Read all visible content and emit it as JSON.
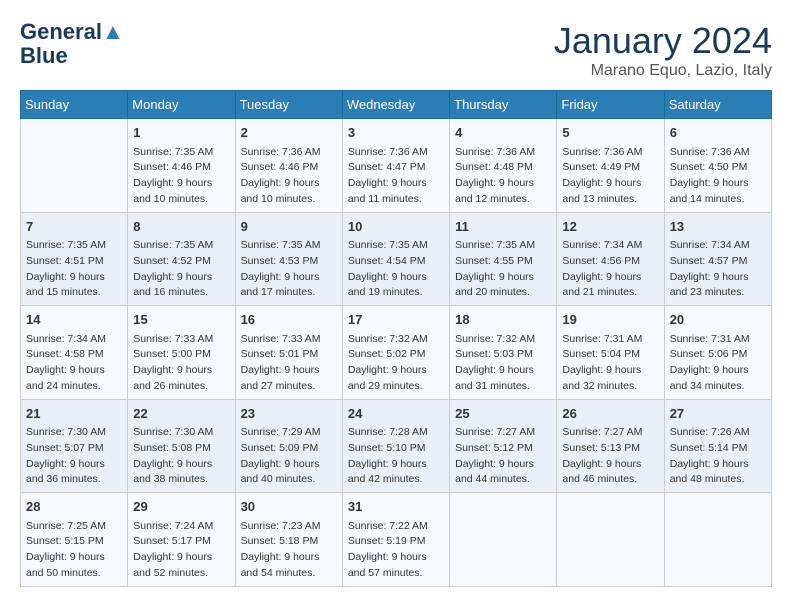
{
  "header": {
    "logo_line1": "General",
    "logo_line2": "Blue",
    "month": "January 2024",
    "location": "Marano Equo, Lazio, Italy"
  },
  "weekdays": [
    "Sunday",
    "Monday",
    "Tuesday",
    "Wednesday",
    "Thursday",
    "Friday",
    "Saturday"
  ],
  "weeks": [
    [
      {
        "day": "",
        "content": ""
      },
      {
        "day": "1",
        "content": "Sunrise: 7:35 AM\nSunset: 4:46 PM\nDaylight: 9 hours\nand 10 minutes."
      },
      {
        "day": "2",
        "content": "Sunrise: 7:36 AM\nSunset: 4:46 PM\nDaylight: 9 hours\nand 10 minutes."
      },
      {
        "day": "3",
        "content": "Sunrise: 7:36 AM\nSunset: 4:47 PM\nDaylight: 9 hours\nand 11 minutes."
      },
      {
        "day": "4",
        "content": "Sunrise: 7:36 AM\nSunset: 4:48 PM\nDaylight: 9 hours\nand 12 minutes."
      },
      {
        "day": "5",
        "content": "Sunrise: 7:36 AM\nSunset: 4:49 PM\nDaylight: 9 hours\nand 13 minutes."
      },
      {
        "day": "6",
        "content": "Sunrise: 7:36 AM\nSunset: 4:50 PM\nDaylight: 9 hours\nand 14 minutes."
      }
    ],
    [
      {
        "day": "7",
        "content": "Sunrise: 7:35 AM\nSunset: 4:51 PM\nDaylight: 9 hours\nand 15 minutes."
      },
      {
        "day": "8",
        "content": "Sunrise: 7:35 AM\nSunset: 4:52 PM\nDaylight: 9 hours\nand 16 minutes."
      },
      {
        "day": "9",
        "content": "Sunrise: 7:35 AM\nSunset: 4:53 PM\nDaylight: 9 hours\nand 17 minutes."
      },
      {
        "day": "10",
        "content": "Sunrise: 7:35 AM\nSunset: 4:54 PM\nDaylight: 9 hours\nand 19 minutes."
      },
      {
        "day": "11",
        "content": "Sunrise: 7:35 AM\nSunset: 4:55 PM\nDaylight: 9 hours\nand 20 minutes."
      },
      {
        "day": "12",
        "content": "Sunrise: 7:34 AM\nSunset: 4:56 PM\nDaylight: 9 hours\nand 21 minutes."
      },
      {
        "day": "13",
        "content": "Sunrise: 7:34 AM\nSunset: 4:57 PM\nDaylight: 9 hours\nand 23 minutes."
      }
    ],
    [
      {
        "day": "14",
        "content": "Sunrise: 7:34 AM\nSunset: 4:58 PM\nDaylight: 9 hours\nand 24 minutes."
      },
      {
        "day": "15",
        "content": "Sunrise: 7:33 AM\nSunset: 5:00 PM\nDaylight: 9 hours\nand 26 minutes."
      },
      {
        "day": "16",
        "content": "Sunrise: 7:33 AM\nSunset: 5:01 PM\nDaylight: 9 hours\nand 27 minutes."
      },
      {
        "day": "17",
        "content": "Sunrise: 7:32 AM\nSunset: 5:02 PM\nDaylight: 9 hours\nand 29 minutes."
      },
      {
        "day": "18",
        "content": "Sunrise: 7:32 AM\nSunset: 5:03 PM\nDaylight: 9 hours\nand 31 minutes."
      },
      {
        "day": "19",
        "content": "Sunrise: 7:31 AM\nSunset: 5:04 PM\nDaylight: 9 hours\nand 32 minutes."
      },
      {
        "day": "20",
        "content": "Sunrise: 7:31 AM\nSunset: 5:06 PM\nDaylight: 9 hours\nand 34 minutes."
      }
    ],
    [
      {
        "day": "21",
        "content": "Sunrise: 7:30 AM\nSunset: 5:07 PM\nDaylight: 9 hours\nand 36 minutes."
      },
      {
        "day": "22",
        "content": "Sunrise: 7:30 AM\nSunset: 5:08 PM\nDaylight: 9 hours\nand 38 minutes."
      },
      {
        "day": "23",
        "content": "Sunrise: 7:29 AM\nSunset: 5:09 PM\nDaylight: 9 hours\nand 40 minutes."
      },
      {
        "day": "24",
        "content": "Sunrise: 7:28 AM\nSunset: 5:10 PM\nDaylight: 9 hours\nand 42 minutes."
      },
      {
        "day": "25",
        "content": "Sunrise: 7:27 AM\nSunset: 5:12 PM\nDaylight: 9 hours\nand 44 minutes."
      },
      {
        "day": "26",
        "content": "Sunrise: 7:27 AM\nSunset: 5:13 PM\nDaylight: 9 hours\nand 46 minutes."
      },
      {
        "day": "27",
        "content": "Sunrise: 7:26 AM\nSunset: 5:14 PM\nDaylight: 9 hours\nand 48 minutes."
      }
    ],
    [
      {
        "day": "28",
        "content": "Sunrise: 7:25 AM\nSunset: 5:15 PM\nDaylight: 9 hours\nand 50 minutes."
      },
      {
        "day": "29",
        "content": "Sunrise: 7:24 AM\nSunset: 5:17 PM\nDaylight: 9 hours\nand 52 minutes."
      },
      {
        "day": "30",
        "content": "Sunrise: 7:23 AM\nSunset: 5:18 PM\nDaylight: 9 hours\nand 54 minutes."
      },
      {
        "day": "31",
        "content": "Sunrise: 7:22 AM\nSunset: 5:19 PM\nDaylight: 9 hours\nand 57 minutes."
      },
      {
        "day": "",
        "content": ""
      },
      {
        "day": "",
        "content": ""
      },
      {
        "day": "",
        "content": ""
      }
    ]
  ]
}
